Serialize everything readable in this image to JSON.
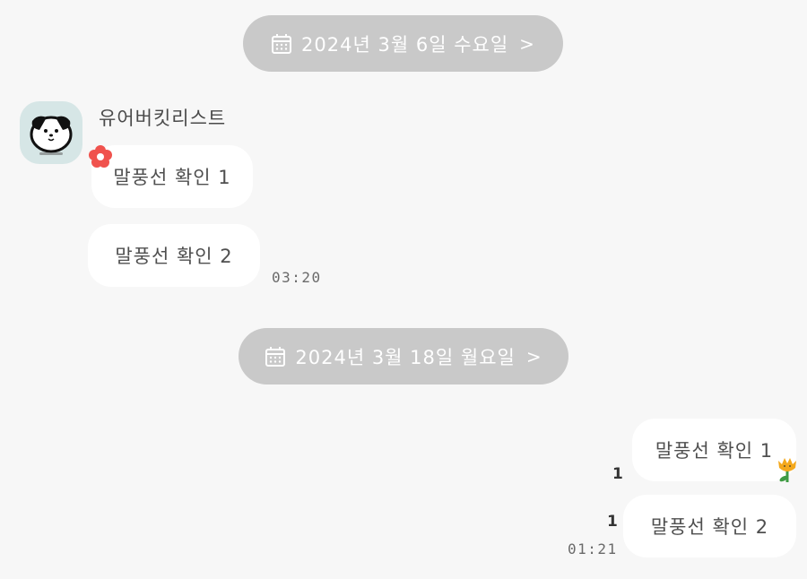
{
  "date_separators": [
    {
      "label": "2024년 3월 6일 수요일",
      "icon": "calendar-icon",
      "chevron": ">"
    },
    {
      "label": "2024년 3월 18일 월요일",
      "icon": "calendar-icon",
      "chevron": ">"
    }
  ],
  "incoming": {
    "sender": "유어버킷리스트",
    "avatar_icon": "puppy-avatar-icon",
    "messages": [
      {
        "text": "말풍선 확인 1",
        "sticker": "red-flower-icon"
      },
      {
        "text": "말풍선 확인 2"
      }
    ],
    "time": "03:20"
  },
  "outgoing": {
    "messages": [
      {
        "text": "말풍선 확인 1",
        "unread": "1",
        "sticker": "yellow-tulip-icon"
      },
      {
        "text": "말풍선 확인 2",
        "unread": "1"
      }
    ],
    "time": "01:21"
  },
  "colors": {
    "background": "#f7f7f7",
    "pill": "#c9c9c9",
    "bubble": "#ffffff",
    "avatar_bg": "#d6e6e6"
  }
}
